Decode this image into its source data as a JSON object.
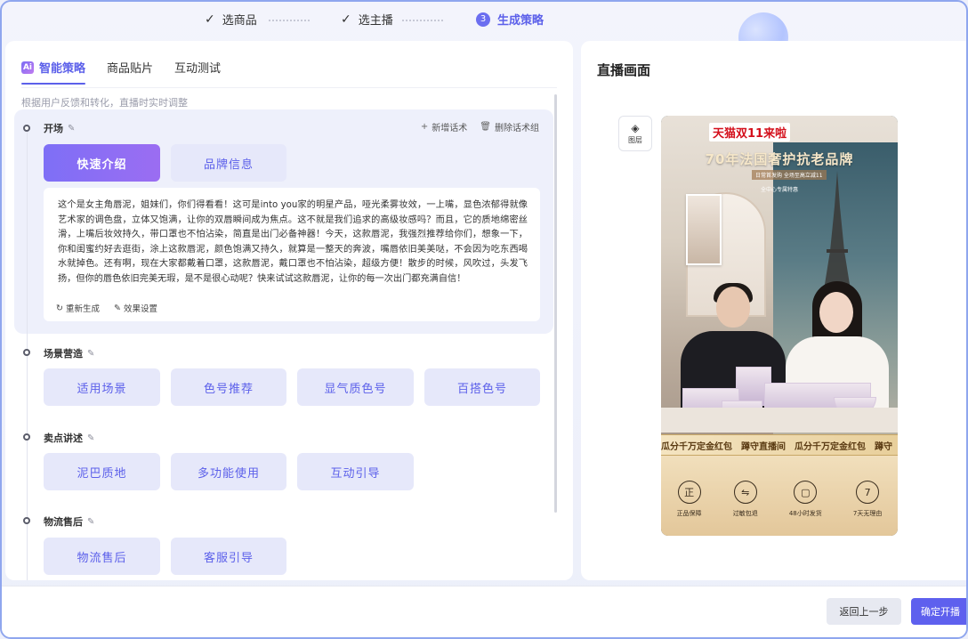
{
  "stepper": {
    "steps": [
      {
        "label": "选商品",
        "state": "done"
      },
      {
        "label": "选主播",
        "state": "done"
      },
      {
        "label": "生成策略",
        "state": "active",
        "number": "3"
      }
    ]
  },
  "left": {
    "tabs": [
      {
        "label": "智能策略",
        "active": true,
        "icon": "ai-strategy-icon"
      },
      {
        "label": "商品贴片",
        "active": false
      },
      {
        "label": "互动测试",
        "active": false
      }
    ],
    "hint": "根据用户反馈和转化，直播时实时调整",
    "actions": {
      "add_script": "新增话术",
      "delete_group": "删除话术组"
    },
    "sections": [
      {
        "title": "开场",
        "options": [
          "快速介绍",
          "品牌信息"
        ],
        "script": "这个是女主角唇泥，姐妹们，你们得看看！这可是into you家的明星产品，哑光柔雾妆效，一上嘴，显色浓郁得就像艺术家的调色盘，立体又饱满，让你的双唇瞬间成为焦点。这不就是我们追求的高级妆感吗？而且，它的质地绵密丝滑，上嘴后妆效持久，带口罩也不怕沾染，简直是出门必备神器！今天，这款唇泥，我强烈推荐给你们，想象一下，你和闺蜜约好去逛街，涂上这款唇泥，颜色饱满又持久，就算是一整天的奔波，嘴唇依旧美美哒，不会因为吃东西喝水就掉色。还有啊，现在大家都戴着口罩，这款唇泥，戴口罩也不怕沾染，超级方便！散步的时候，风吹过，头发飞扬，但你的唇色依旧完美无瑕，是不是很心动呢？快来试试这款唇泥，让你的每一次出门都充满自信！",
        "regenerate": "重新生成",
        "effect_settings": "效果设置"
      },
      {
        "title": "场景营造",
        "options": [
          "适用场景",
          "色号推荐",
          "显气质色号",
          "百搭色号"
        ]
      },
      {
        "title": "卖点讲述",
        "options": [
          "泥巴质地",
          "多功能使用",
          "互动引导"
        ]
      },
      {
        "title": "物流售后",
        "options": [
          "物流售后",
          "客服引导"
        ]
      }
    ]
  },
  "right": {
    "title": "直播画面",
    "layer_label": "图层",
    "preview": {
      "banner_top": "天猫双11来啦",
      "banner_main": "70年法国奢护抗老品牌",
      "banner_sub1": "日常首发购 全场至高立减11",
      "banner_sub2": "全中心专属特惠",
      "ticker": [
        "瓜分千万定金红包",
        "蹲守直播间",
        "瓜分千万定金红包",
        "蹲守"
      ],
      "guarantees": [
        {
          "icon": "正",
          "label": "正品保障"
        },
        {
          "icon": "⇋",
          "label": "过敏包退"
        },
        {
          "icon": "▢",
          "label": "48小时发货"
        },
        {
          "icon": "7",
          "label": "7天无理由"
        }
      ]
    }
  },
  "footer": {
    "back": "返回上一步",
    "confirm": "确定开播"
  }
}
